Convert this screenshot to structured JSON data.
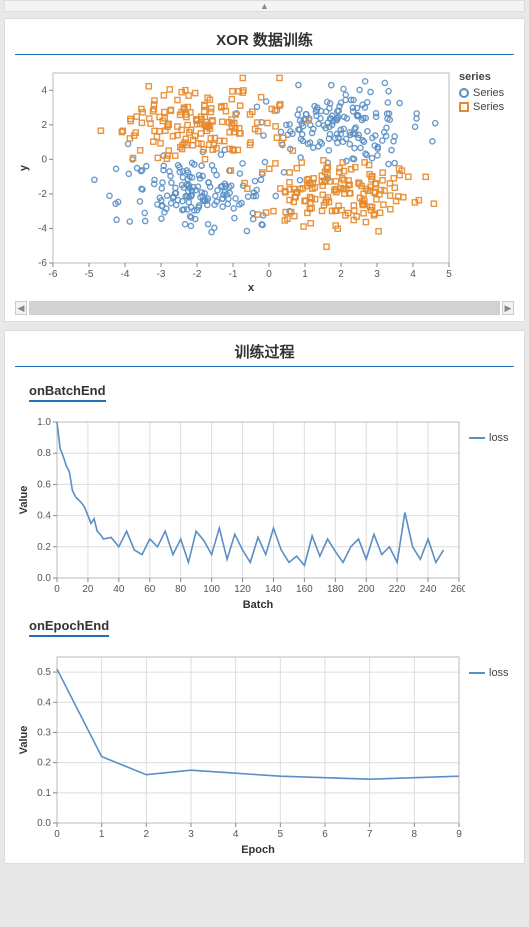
{
  "panel1": {
    "title": "XOR 数据训练",
    "legend_title": "series",
    "legend_items": [
      "Series",
      "Series"
    ]
  },
  "panel2": {
    "title": "训练过程",
    "sub1_title": "onBatchEnd",
    "sub2_title": "onEpochEnd",
    "legend_loss": "loss"
  },
  "chart_data": [
    {
      "type": "scatter",
      "title": "XOR 数据训练",
      "xlabel": "x",
      "ylabel": "y",
      "xlim": [
        -6,
        5
      ],
      "ylim": [
        -6,
        5
      ],
      "xticks": [
        -6,
        -5,
        -4,
        -3,
        -2,
        -1,
        0,
        1,
        2,
        3,
        4,
        5
      ],
      "yticks": [
        -6,
        -4,
        -2,
        0,
        2,
        4
      ],
      "legend_title": "series",
      "series": [
        {
          "name": "Series",
          "marker": "circle",
          "color": "#5a8fc5",
          "cluster_centers": [
            [
              -2,
              -2
            ],
            [
              2,
              2
            ]
          ],
          "cluster_spread": 1.5,
          "points_per_cluster": 160
        },
        {
          "name": "Series",
          "marker": "square",
          "color": "#e58a2e",
          "cluster_centers": [
            [
              -2,
              2
            ],
            [
              2,
              -2
            ]
          ],
          "cluster_spread": 1.5,
          "points_per_cluster": 160
        }
      ]
    },
    {
      "type": "line",
      "title": "onBatchEnd",
      "xlabel": "Batch",
      "ylabel": "Value",
      "xlim": [
        0,
        260
      ],
      "ylim": [
        0.0,
        1.0
      ],
      "xticks": [
        0,
        20,
        40,
        60,
        80,
        100,
        120,
        140,
        160,
        180,
        200,
        220,
        240,
        260
      ],
      "yticks": [
        0.0,
        0.2,
        0.4,
        0.6,
        0.8,
        1.0
      ],
      "series": [
        {
          "name": "loss",
          "color": "#5a8fc5",
          "x": [
            0,
            2,
            4,
            6,
            8,
            10,
            12,
            14,
            16,
            18,
            20,
            22,
            24,
            26,
            28,
            30,
            35,
            40,
            45,
            50,
            55,
            60,
            65,
            70,
            75,
            80,
            85,
            90,
            95,
            100,
            105,
            110,
            115,
            120,
            125,
            130,
            135,
            140,
            145,
            150,
            155,
            160,
            165,
            170,
            175,
            180,
            185,
            190,
            195,
            200,
            205,
            210,
            215,
            220,
            225,
            230,
            235,
            240,
            245,
            250
          ],
          "values": [
            1.0,
            0.83,
            0.78,
            0.72,
            0.68,
            0.56,
            0.52,
            0.5,
            0.48,
            0.45,
            0.4,
            0.35,
            0.38,
            0.3,
            0.28,
            0.25,
            0.26,
            0.2,
            0.3,
            0.18,
            0.15,
            0.25,
            0.2,
            0.3,
            0.15,
            0.25,
            0.1,
            0.3,
            0.24,
            0.15,
            0.32,
            0.12,
            0.28,
            0.18,
            0.1,
            0.26,
            0.15,
            0.32,
            0.18,
            0.1,
            0.14,
            0.08,
            0.27,
            0.14,
            0.25,
            0.17,
            0.1,
            0.2,
            0.25,
            0.12,
            0.28,
            0.15,
            0.2,
            0.1,
            0.42,
            0.2,
            0.12,
            0.25,
            0.1,
            0.18
          ]
        }
      ]
    },
    {
      "type": "line",
      "title": "onEpochEnd",
      "xlabel": "Epoch",
      "ylabel": "Value",
      "xlim": [
        0,
        9
      ],
      "ylim": [
        0.0,
        0.55
      ],
      "xticks": [
        0,
        1,
        2,
        3,
        4,
        5,
        6,
        7,
        8,
        9
      ],
      "yticks": [
        0.0,
        0.1,
        0.2,
        0.3,
        0.4,
        0.5
      ],
      "series": [
        {
          "name": "loss",
          "color": "#5a8fc5",
          "x": [
            0,
            1,
            2,
            3,
            4,
            5,
            6,
            7,
            8,
            9
          ],
          "values": [
            0.51,
            0.22,
            0.16,
            0.175,
            0.165,
            0.155,
            0.15,
            0.145,
            0.15,
            0.155
          ]
        }
      ]
    }
  ]
}
